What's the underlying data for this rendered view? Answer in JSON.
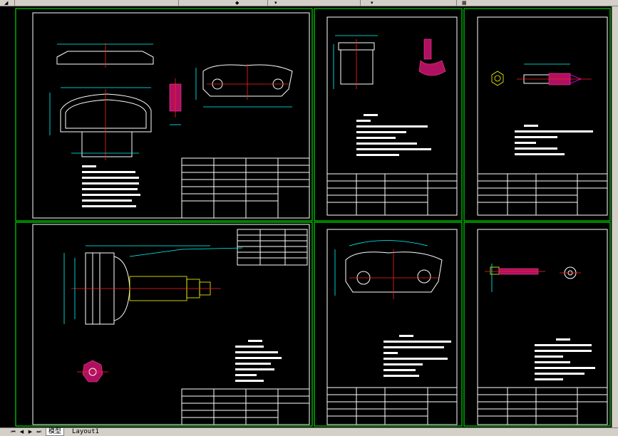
{
  "toolbar": {
    "items": [
      "",
      "",
      ""
    ]
  },
  "tabs": {
    "model_label": "模型",
    "layout_label": "Layout1"
  },
  "colors": {
    "background": "#000000",
    "frame": "#00ff00",
    "border": "#ffffff",
    "dimension": "#00ffff",
    "centerline": "#ff2020",
    "hatch": "#b01060"
  },
  "sheets": [
    {
      "title_note": "",
      "tech_title": ""
    },
    {
      "title_note": "",
      "tech_title": ""
    },
    {
      "title_note": "",
      "tech_title": ""
    },
    {
      "title_note": "",
      "tech_title": ""
    },
    {
      "title_note": "",
      "tech_title": ""
    },
    {
      "title_note": "",
      "tech_title": ""
    }
  ]
}
